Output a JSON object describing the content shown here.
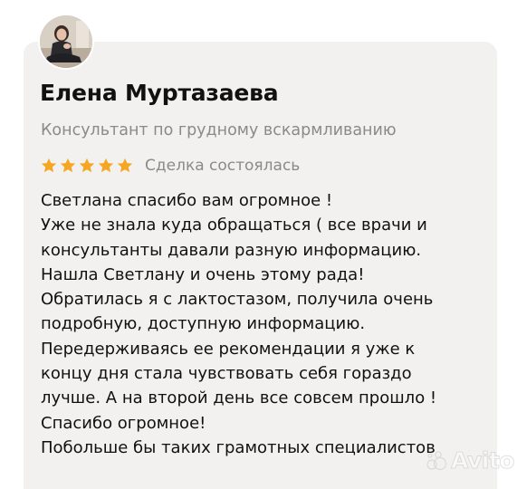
{
  "reviewer": {
    "name": "Елена Муртазаева",
    "subtitle": "Консультант по грудному вскармливанию"
  },
  "rating": {
    "stars": 5,
    "max_stars": 5,
    "star_color": "#f5a623",
    "deal_status": "Сделка состоялась"
  },
  "review": {
    "lines": [
      "Светлана спасибо вам огромное !",
      "Уже не знала куда обращаться ( все врачи и",
      "консультанты давали разную информацию.",
      "Нашла Светлану и очень этому рада!",
      "Обратилась я с лактостазом, получила очень",
      "подробную, доступную информацию.",
      "Передерживаясь ее рекомендации я уже к",
      "концу дня стала чувствовать себя гораздо",
      "лучше. А на второй день все совсем прошло !",
      "Спасибо огромное!",
      "Побольше бы таких грамотных специалистов"
    ]
  },
  "watermark": {
    "text": "Avito"
  },
  "colors": {
    "card_background": "#f2f1f0",
    "text_primary": "#111111",
    "text_secondary": "#8a8a8a"
  },
  "icons": {
    "avatar": "user-photo",
    "star": "star-icon",
    "watermark": "avito-logo"
  }
}
